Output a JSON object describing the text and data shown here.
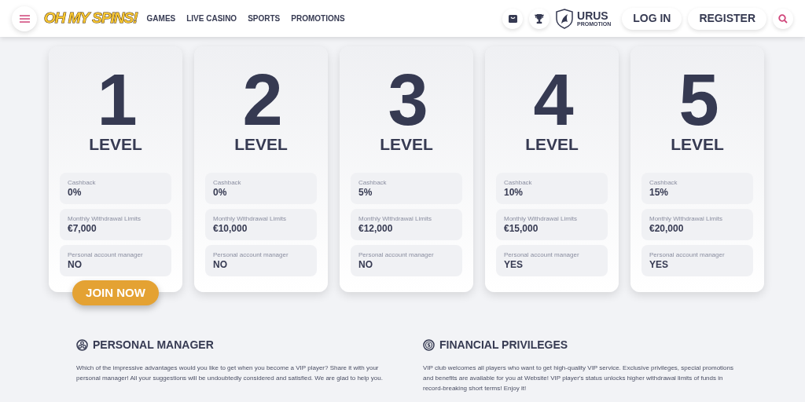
{
  "header": {
    "logo": "OH MY SPINS!",
    "nav": [
      "GAMES",
      "LIVE CASINO",
      "SPORTS",
      "PROMOTIONS"
    ],
    "partner": {
      "name": "URUS",
      "tagline": "PROMOTION"
    },
    "login": "LOG IN",
    "register": "REGISTER"
  },
  "levels": [
    {
      "number": "1",
      "label": "LEVEL",
      "stats": [
        {
          "label": "Cashback",
          "value": "0%"
        },
        {
          "label": "Monthly Withdrawal Limits",
          "value": "€7,000"
        },
        {
          "label": "Personal account manager",
          "value": "NO"
        }
      ]
    },
    {
      "number": "2",
      "label": "LEVEL",
      "stats": [
        {
          "label": "Cashback",
          "value": "0%"
        },
        {
          "label": "Monthly Withdrawal Limits",
          "value": "€10,000"
        },
        {
          "label": "Personal account manager",
          "value": "NO"
        }
      ]
    },
    {
      "number": "3",
      "label": "LEVEL",
      "stats": [
        {
          "label": "Cashback",
          "value": "5%"
        },
        {
          "label": "Monthly Withdrawal Limits",
          "value": "€12,000"
        },
        {
          "label": "Personal account manager",
          "value": "NO"
        }
      ]
    },
    {
      "number": "4",
      "label": "LEVEL",
      "stats": [
        {
          "label": "Cashback",
          "value": "10%"
        },
        {
          "label": "Monthly Withdrawal Limits",
          "value": "€15,000"
        },
        {
          "label": "Personal account manager",
          "value": "YES"
        }
      ]
    },
    {
      "number": "5",
      "label": "LEVEL",
      "stats": [
        {
          "label": "Cashback",
          "value": "15%"
        },
        {
          "label": "Monthly Withdrawal Limits",
          "value": "€20,000"
        },
        {
          "label": "Personal account manager",
          "value": "YES"
        }
      ]
    }
  ],
  "join_button": "JOIN NOW",
  "sections": [
    {
      "kind": "manager",
      "title": "PERSONAL MANAGER",
      "text": "Which of the impressive advantages would you like to get when you become a VIP player? Share it with your personal manager! All your suggestions will be undoubtedly considered and satisfied. We are glad to help you."
    },
    {
      "kind": "money",
      "title": "FINANCIAL PRIVILEGES",
      "text": "VIP club welcomes all players who want to get high-quality VIP service. Exclusive privileges, special promotions and benefits are available for you at Website! VIP player's status unlocks higher withdrawal limits of funds in record-breaking short terms! Enjoy it!"
    }
  ]
}
